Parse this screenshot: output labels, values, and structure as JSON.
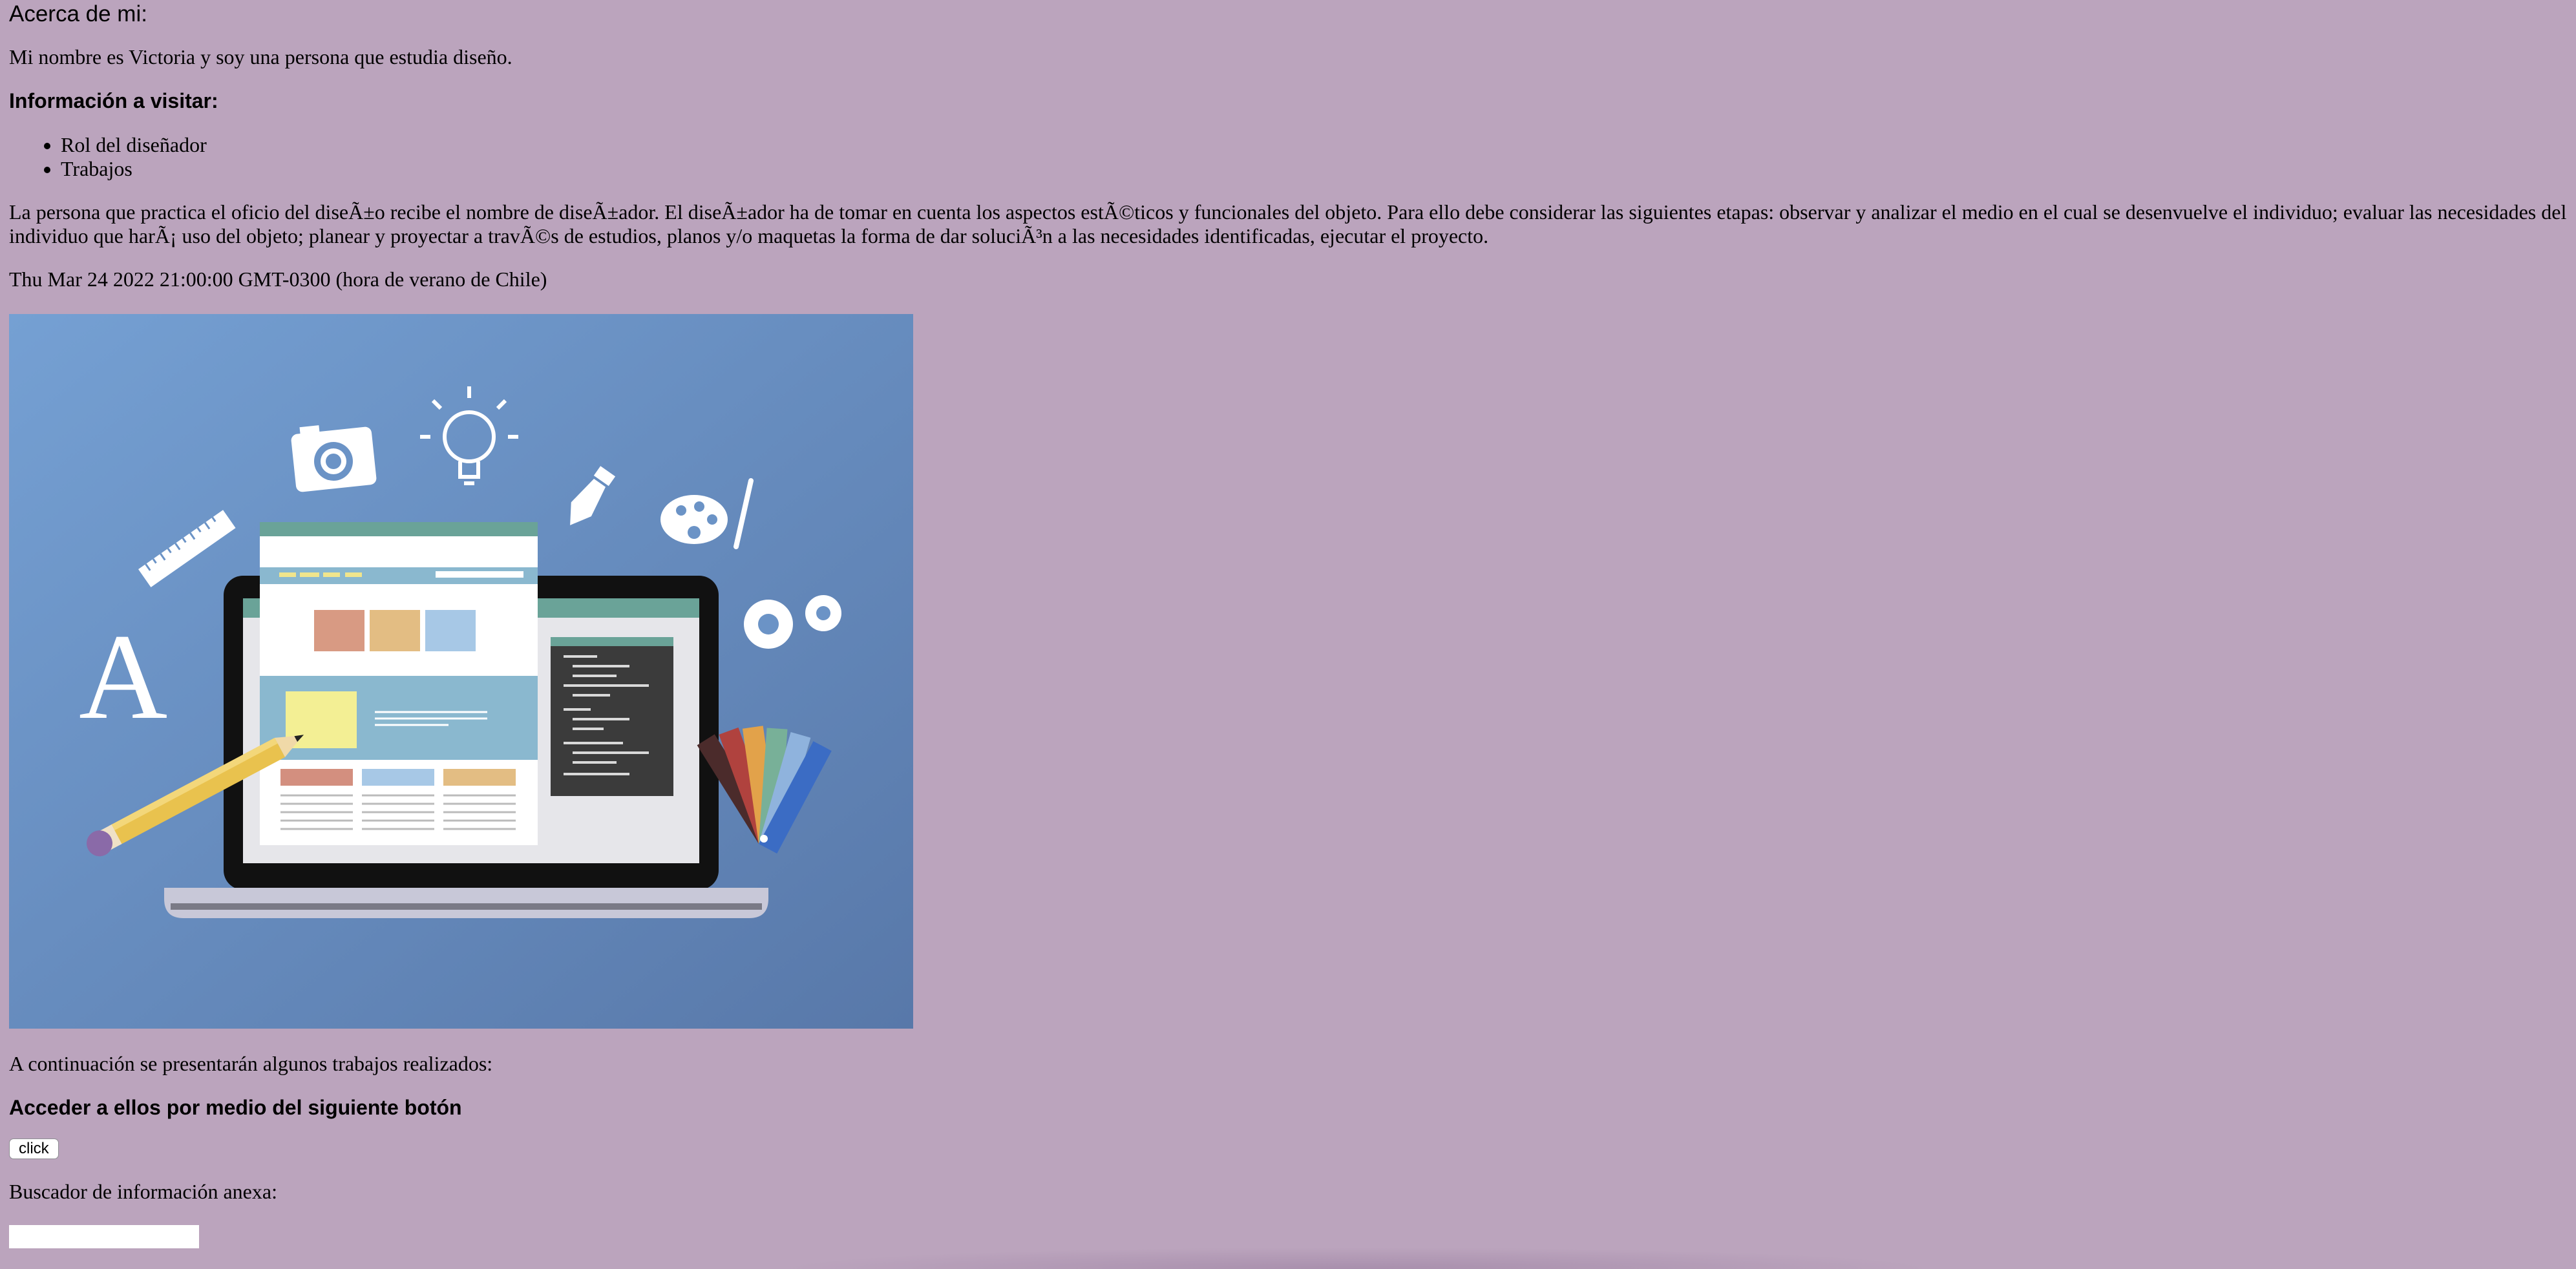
{
  "page": {
    "about_title": "Acerca de mi:",
    "intro": "Mi nombre es Victoria y soy una persona que estudia diseño.",
    "info_heading": "Información a visitar:",
    "info_items": [
      "Rol del diseñador",
      "Trabajos"
    ],
    "role_paragraph": "La persona que practica el oficio del diseÃ±o recibe el nombre de diseÃ±ador. El diseÃ±ador ha de tomar en cuenta los aspectos estÃ©ticos y funcionales del objeto. Para ello debe considerar las siguientes etapas: observar y analizar el medio en el cual se desenvuelve el individuo; evaluar las necesidades del individuo que harÃ¡ uso del objeto; planear y proyectar a travÃ©s de estudios, planos y/o maquetas la forma de dar soluciÃ³n a las necesidades identificadas, ejecutar el proyecto.",
    "date_line": "Thu Mar 24 2022 21:00:00 GMT-0300 (hora de verano de Chile)",
    "works_intro": "A continuación se presentarán algunos trabajos realizados:",
    "access_heading": "Acceder a ellos por medio del siguiente botón",
    "button_label": "click",
    "search_label": "Buscador de información anexa:",
    "search_value": "",
    "illustration_letter": "A"
  },
  "colors": {
    "page_background": "#bba4bd",
    "image_background": "#6b93c6"
  }
}
